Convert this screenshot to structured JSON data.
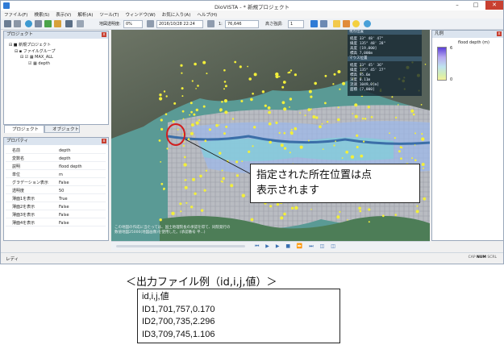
{
  "window": {
    "title": "DioVISTA - * 新規プロジェクト"
  },
  "menu": [
    "ファイル(F)",
    "検索(S)",
    "表示(V)",
    "解析(A)",
    "ツール(T)",
    "ウィンドウ(W)",
    "お気に入り(A)",
    "ヘルプ(H)"
  ],
  "toolbar": {
    "transparency_label": "地図透明度:",
    "transparency_value": "0%",
    "datetime": "2016/10/28 22:24",
    "scale_prefix": "1:",
    "scale_value": "76,646",
    "exaggeration_label": "高さ強調:",
    "exaggeration_value": "1"
  },
  "project_panel": {
    "title": "プロジェクト",
    "tree": [
      "新規プロジェクト",
      "ファイルグループ",
      "MAX_ALL",
      "depth"
    ]
  },
  "tabs": [
    "プロジェクト",
    "オブジェクト"
  ],
  "properties_panel": {
    "title": "プロパティ",
    "rows": [
      {
        "k": "名前",
        "v": "depth"
      },
      {
        "k": "変数名",
        "v": "depth"
      },
      {
        "k": "説明",
        "v": "flood depth"
      },
      {
        "k": "単位",
        "v": "m"
      },
      {
        "k": "グラデーション表示",
        "v": "False"
      },
      {
        "k": "透明度",
        "v": "50"
      },
      {
        "k": "薄面1を表示",
        "v": "True"
      },
      {
        "k": "薄面2を表示",
        "v": "False"
      },
      {
        "k": "薄面3を表示",
        "v": "False"
      },
      {
        "k": "薄面4を表示",
        "v": "False"
      }
    ]
  },
  "map_info": {
    "section1": "視点位置",
    "s1_rows": [
      "経度   33° 48' 47\"",
      "緯度  135° 48' 28\"",
      "高度  [19,000]",
      "標高     7,000m"
    ],
    "section2": "マウス位置",
    "s2_rows": [
      "経度   33° 45' 36\"",
      "緯度  135° 45' 27\"",
      "標高     95.6m",
      "深度    0.11m",
      "流速   1049,0[m]",
      "面積     [7,000]"
    ]
  },
  "map_attribution": [
    "この地図の作成に当たっては、国土地理院長の承認を得て、同院発行の",
    "数値地図25000(地図画像)を使用した。(承認番号 平...)"
  ],
  "legend_panel": {
    "title": "凡例",
    "label": "flood depth (m)",
    "max_label": "6",
    "min_label": "0"
  },
  "status": {
    "ready": "レディ",
    "indicators": [
      "CAP",
      "NUM",
      "SCRL"
    ]
  },
  "callout": {
    "line1": "指定された所在位置は点",
    "line2": "表示されます"
  },
  "caption": "＜出力ファイル例（id,i,j,値）＞",
  "csv": [
    "id,i,j,値",
    "ID1,701,757,0.170",
    "ID2,700,735,2.296",
    "ID3,709,745,1.106"
  ],
  "colors": {
    "accent": "#2f7bd6",
    "close_red": "#c84031",
    "highlight_circle": "#d21e1e",
    "point_yellow": "#f2ef3a"
  }
}
